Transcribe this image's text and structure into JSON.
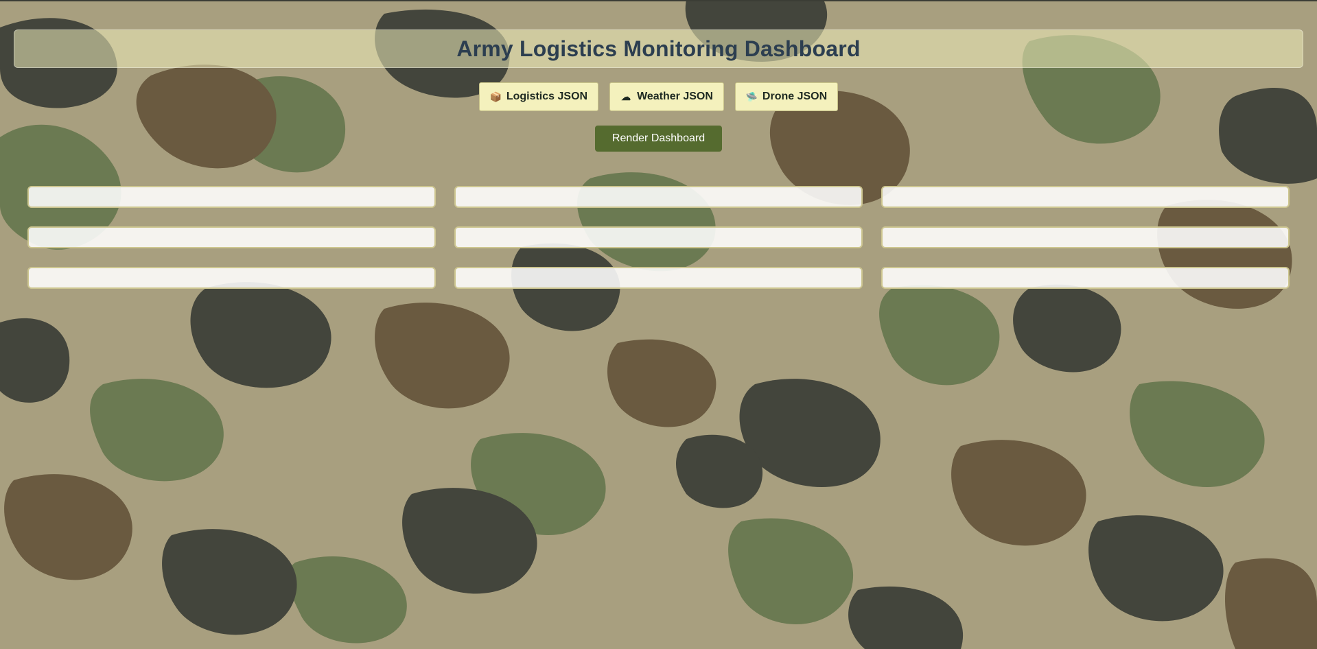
{
  "header": {
    "title": "Army Logistics Monitoring Dashboard"
  },
  "loaders": [
    {
      "icon": "box-icon",
      "glyph": "📦",
      "label": "Logistics JSON"
    },
    {
      "icon": "cloud-icon",
      "glyph": "☁",
      "label": "Weather JSON"
    },
    {
      "icon": "drone-icon",
      "glyph": "🛸",
      "label": "Drone JSON"
    }
  ],
  "render_button": {
    "label": "Render Dashboard"
  },
  "colors": {
    "title": "#2c3e50",
    "render_button": "#556b2f",
    "loader_button": "#f4f1bd",
    "camo_light": "#a89f7f",
    "camo_green": "#6b7a52",
    "camo_brown": "#6a5a40",
    "camo_dark": "#43453c"
  }
}
